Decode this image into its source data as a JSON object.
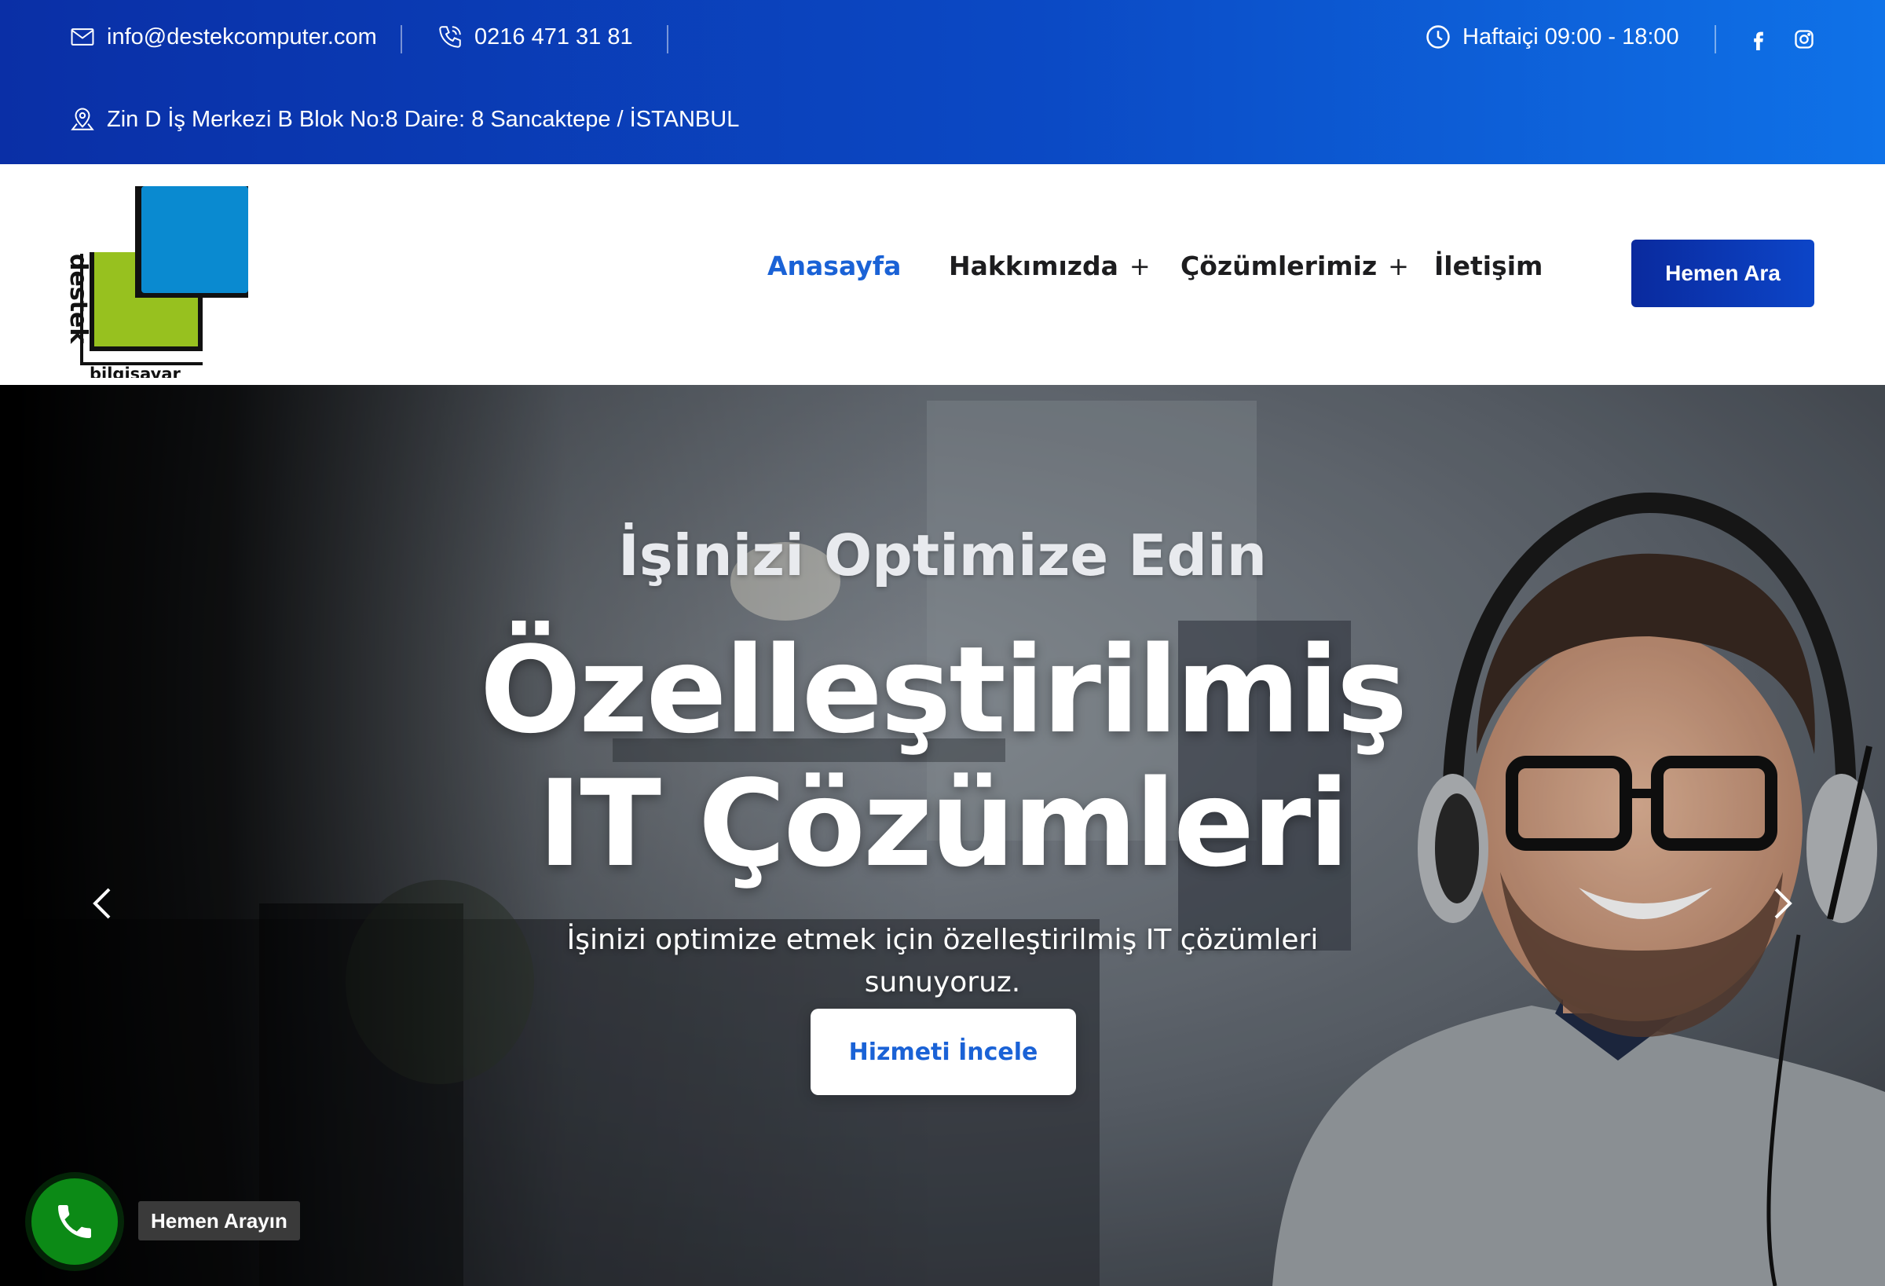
{
  "topbar": {
    "email": "info@destekcomputer.com",
    "phone": "0216 471 31 81",
    "hours": "Haftaiçi 09:00 - 18:00",
    "address": "Zin D İş Merkezi B Blok No:8 Daire: 8 Sancaktepe / İSTANBUL",
    "icons": [
      "mail-icon",
      "phone-icon",
      "clock-icon",
      "location-icon",
      "facebook-icon",
      "instagram-icon"
    ]
  },
  "logo": {
    "word_vertical": "destek",
    "word_horizontal": "bilgisayar",
    "colors": {
      "blue": "#0a8ad0",
      "green": "#97c11f"
    }
  },
  "nav": {
    "items": [
      {
        "label": "Anasayfa",
        "active": true,
        "has_submenu": false
      },
      {
        "label": "Hakkımızda",
        "active": false,
        "has_submenu": true
      },
      {
        "label": "Çözümlerimiz",
        "active": false,
        "has_submenu": true
      },
      {
        "label": "İletişim",
        "active": false,
        "has_submenu": false
      }
    ],
    "submenu_symbol": "+",
    "cta_label": "Hemen Ara"
  },
  "hero": {
    "subtitle": "İşinizi Optimize Edin",
    "title_line1": "Özelleştirilmiş",
    "title_line2": "IT Çözümleri",
    "description": "İşinizi optimize etmek için özelleştirilmiş IT çözümleri sunuyoruz.",
    "button_label": "Hizmeti İncele"
  },
  "floating_call": {
    "label": "Hemen Arayın"
  },
  "colors": {
    "topbar_start": "#0a2fa6",
    "topbar_end": "#0f72e8",
    "accent": "#1a62d6",
    "cta": "#0c3bb8",
    "call_green": "#0c8a16"
  }
}
